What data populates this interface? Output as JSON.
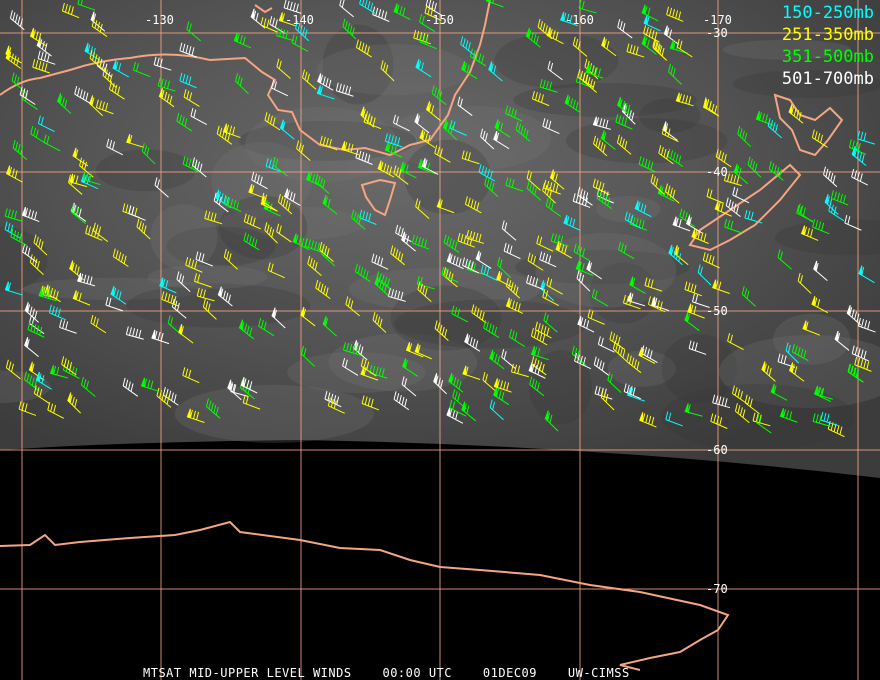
{
  "title": "MTSAT MID-UPPER LEVEL WINDS",
  "time": "00:00 UTC",
  "date": "01DEC09",
  "credit": "UW-CIMSS",
  "legend": [
    {
      "label": "150-250mb",
      "color": "#00ffff"
    },
    {
      "label": "251-350mb",
      "color": "#ffff00"
    },
    {
      "label": "351-500mb",
      "color": "#00ff00"
    },
    {
      "label": "501-700mb",
      "color": "#ffffff"
    }
  ],
  "longitude_labels": [
    "-130",
    "-140",
    "-150",
    "-160",
    "-170"
  ],
  "latitude_labels": [
    "-30",
    "-40",
    "-50",
    "-60",
    "-70"
  ],
  "colors": {
    "coast": "#f4a582",
    "grid": "#f4a582",
    "grid_dark": "#ffffff"
  }
}
